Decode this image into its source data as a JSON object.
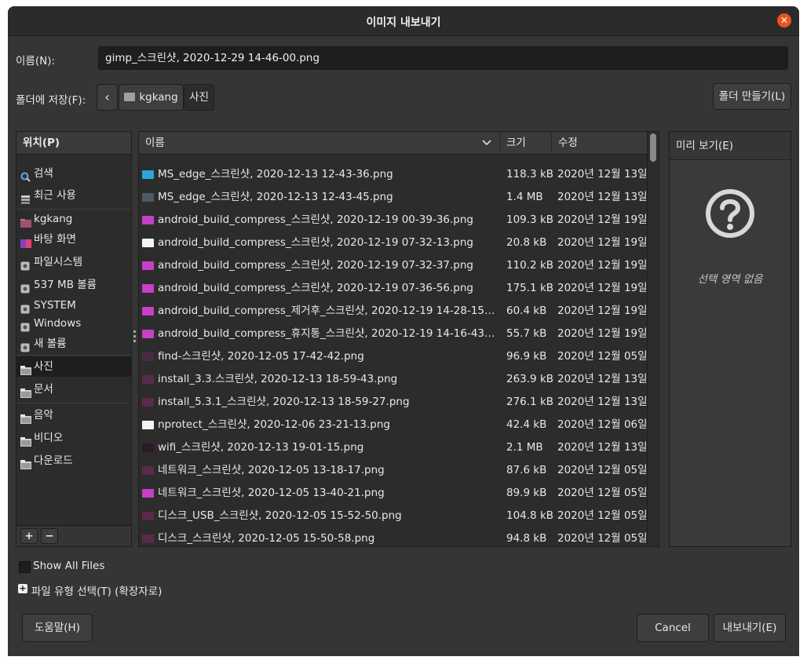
{
  "title": "이미지 내보내기",
  "name_label": "이름(N):",
  "name_value": "gimp_스크린샷, 2020-12-29 14-46-00.png",
  "folder_label": "폴더에 저장(F):",
  "path_home": "kgkang",
  "path_current": "사진",
  "new_folder_label": "폴더 만들기(L)",
  "places": {
    "header": "위치(P)",
    "items": [
      {
        "label": "검색",
        "icon": "search-icon"
      },
      {
        "label": "최근 사용",
        "icon": "recent-icon"
      },
      {
        "label": "kgkang",
        "icon": "home-folder-icon"
      },
      {
        "label": "바탕 화면",
        "icon": "desktop-icon"
      },
      {
        "label": "파일시스템",
        "icon": "drive-icon"
      },
      {
        "label": "537 MB 볼륨",
        "icon": "drive-icon"
      },
      {
        "label": "SYSTEM",
        "icon": "drive-icon"
      },
      {
        "label": "Windows",
        "icon": "drive-icon"
      },
      {
        "label": "새 볼륨",
        "icon": "drive-icon"
      },
      {
        "label": "사진",
        "icon": "folder-icon"
      },
      {
        "label": "문서",
        "icon": "folder-icon"
      },
      {
        "label": "음악",
        "icon": "folder-icon"
      },
      {
        "label": "비디오",
        "icon": "folder-icon"
      },
      {
        "label": "다운로드",
        "icon": "folder-icon"
      }
    ],
    "add_label": "+",
    "remove_label": "−"
  },
  "columns": {
    "name": "이름",
    "size": "크기",
    "modified": "수정"
  },
  "files": [
    {
      "name": "MS_edge_스크린샷, 2020-12-13 12-43-36.png",
      "size": "118.3 kB",
      "date": "2020년 12월 13일",
      "thumb": "#2aa7d6"
    },
    {
      "name": "MS_edge_스크린샷, 2020-12-13 12-43-45.png",
      "size": "1.4 MB",
      "date": "2020년 12월 13일",
      "thumb": "#4b5a66"
    },
    {
      "name": "android_build_compress_스크린샷, 2020-12-19 00-39-36.png",
      "size": "109.3 kB",
      "date": "2020년 12월 19일",
      "thumb": "#c640c8"
    },
    {
      "name": "android_build_compress_스크린샷, 2020-12-19 07-32-13.png",
      "size": "20.8 kB",
      "date": "2020년 12월 19일",
      "thumb": "#f4f4f4"
    },
    {
      "name": "android_build_compress_스크린샷, 2020-12-19 07-32-37.png",
      "size": "110.2 kB",
      "date": "2020년 12월 19일",
      "thumb": "#c640c8"
    },
    {
      "name": "android_build_compress_스크린샷, 2020-12-19 07-36-56.png",
      "size": "175.1 kB",
      "date": "2020년 12월 19일",
      "thumb": "#c640c8"
    },
    {
      "name": "android_build_compress_제거후_스크린샷, 2020-12-19 14-28-15.png",
      "size": "60.4 kB",
      "date": "2020년 12월 19일",
      "thumb": "#c640c8"
    },
    {
      "name": "android_build_compress_휴지통_스크린샷, 2020-12-19 14-16-43.png",
      "size": "55.7 kB",
      "date": "2020년 12월 19일",
      "thumb": "#c640c8"
    },
    {
      "name": "find-스크린샷, 2020-12-05 17-42-42.png",
      "size": "96.9 kB",
      "date": "2020년 12월 05일",
      "thumb": "#4a2a40"
    },
    {
      "name": "install_3.3.스크린샷, 2020-12-13 18-59-43.png",
      "size": "263.9 kB",
      "date": "2020년 12월 13일",
      "thumb": "#5a2a4a"
    },
    {
      "name": "install_5.3.1_스크린샷, 2020-12-13 18-59-27.png",
      "size": "276.1 kB",
      "date": "2020년 12월 13일",
      "thumb": "#5a2a4a"
    },
    {
      "name": "nprotect_스크린샷, 2020-12-06 23-21-13.png",
      "size": "42.4 kB",
      "date": "2020년 12월 06일",
      "thumb": "#f4f4f4"
    },
    {
      "name": "wifi_스크린샷, 2020-12-13 19-01-15.png",
      "size": "2.1 MB",
      "date": "2020년 12월 13일",
      "thumb": "#2a1a2a"
    },
    {
      "name": "네트워크_스크린샷, 2020-12-05 13-18-17.png",
      "size": "87.6 kB",
      "date": "2020년 12월 05일",
      "thumb": "#5a2a4a"
    },
    {
      "name": "네트워크_스크린샷, 2020-12-05 13-40-21.png",
      "size": "89.9 kB",
      "date": "2020년 12월 05일",
      "thumb": "#c640c8"
    },
    {
      "name": "디스크_USB_스크린샷, 2020-12-05 15-52-50.png",
      "size": "104.8 kB",
      "date": "2020년 12월 05일",
      "thumb": "#5a2a4a"
    },
    {
      "name": "디스크_스크린샷, 2020-12-05 15-50-58.png",
      "size": "94.8 kB",
      "date": "2020년 12월 05일",
      "thumb": "#5a2a4a"
    }
  ],
  "preview_label": "미리 보기(E)",
  "no_selection": "선택 영역 없음",
  "show_all_files": "Show All Files",
  "file_type_label": "파일 유형 선택(T) (확장자로)",
  "help_label": "도움말(H)",
  "cancel_label": "Cancel",
  "export_label": "내보내기(E)"
}
